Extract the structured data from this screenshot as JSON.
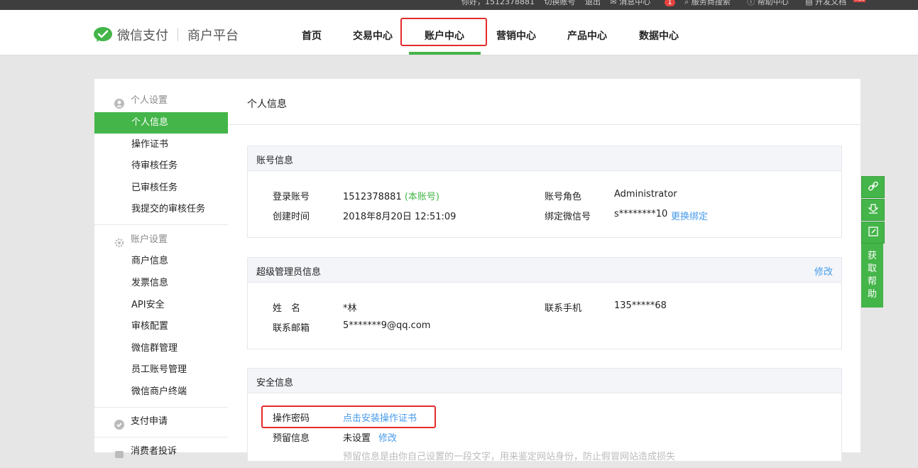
{
  "topbar": {
    "greeting": "你好，1512378881",
    "switch_account": "切换账号",
    "logout": "退出",
    "messages": "消息中心",
    "messages_count": "1",
    "service_search": "服务商搜索",
    "help": "帮助中心",
    "dev_docs": "开发文档",
    "dev_docs_badge": "hot"
  },
  "brand": {
    "name": "微信支付",
    "subtitle": "商户平台"
  },
  "nav": {
    "items": [
      {
        "label": "首页"
      },
      {
        "label": "交易中心"
      },
      {
        "label": "账户中心"
      },
      {
        "label": "营销中心"
      },
      {
        "label": "产品中心"
      },
      {
        "label": "数据中心"
      }
    ],
    "active_index": 2,
    "accent_color": "#44b549"
  },
  "sidebar": {
    "groups": [
      {
        "label": "个人设置",
        "icon": "user-icon",
        "items": [
          "个人信息",
          "操作证书",
          "待审核任务",
          "已审核任务",
          "我提交的审核任务"
        ]
      },
      {
        "label": "账户设置",
        "icon": "gear-icon",
        "items": [
          "商户信息",
          "发票信息",
          "API安全",
          "审核配置",
          "微信群管理",
          "员工账号管理",
          "微信商户终端"
        ]
      },
      {
        "label": "支付申请",
        "icon": "payment-icon",
        "items": []
      },
      {
        "label": "消费者投诉",
        "icon": "complaint-icon",
        "items": []
      }
    ],
    "active_item": "个人信息"
  },
  "main": {
    "title": "个人信息",
    "account_info": {
      "title": "账号信息",
      "login_label": "登录账号",
      "login_value": "1512378881",
      "login_note": "(本账号)",
      "created_label": "创建时间",
      "created_value": "2018年8月20日 12:51:09",
      "role_label": "账号角色",
      "role_value": "Administrator",
      "wechat_label": "绑定微信号",
      "wechat_value": "s********10",
      "wechat_action": "更换绑定"
    },
    "admin_info": {
      "title": "超级管理员信息",
      "edit": "修改",
      "name_label": "姓　名",
      "name_value": "*林",
      "email_label": "联系邮箱",
      "email_value": "5*******9@qq.com",
      "phone_label": "联系手机",
      "phone_value": "135*****68"
    },
    "security_info": {
      "title": "安全信息",
      "op_password_label": "操作密码",
      "op_password_action": "点击安装操作证书",
      "reserved_label": "预留信息",
      "reserved_value": "未设置",
      "reserved_action": "修改",
      "reserved_hint": "预留信息是由你自己设置的一段文字，用来鉴定网站身份，防止假冒网站造成损失"
    }
  },
  "float_help": {
    "label": "获取帮助",
    "icons": [
      "link-icon",
      "download-icon",
      "edit-icon"
    ]
  }
}
